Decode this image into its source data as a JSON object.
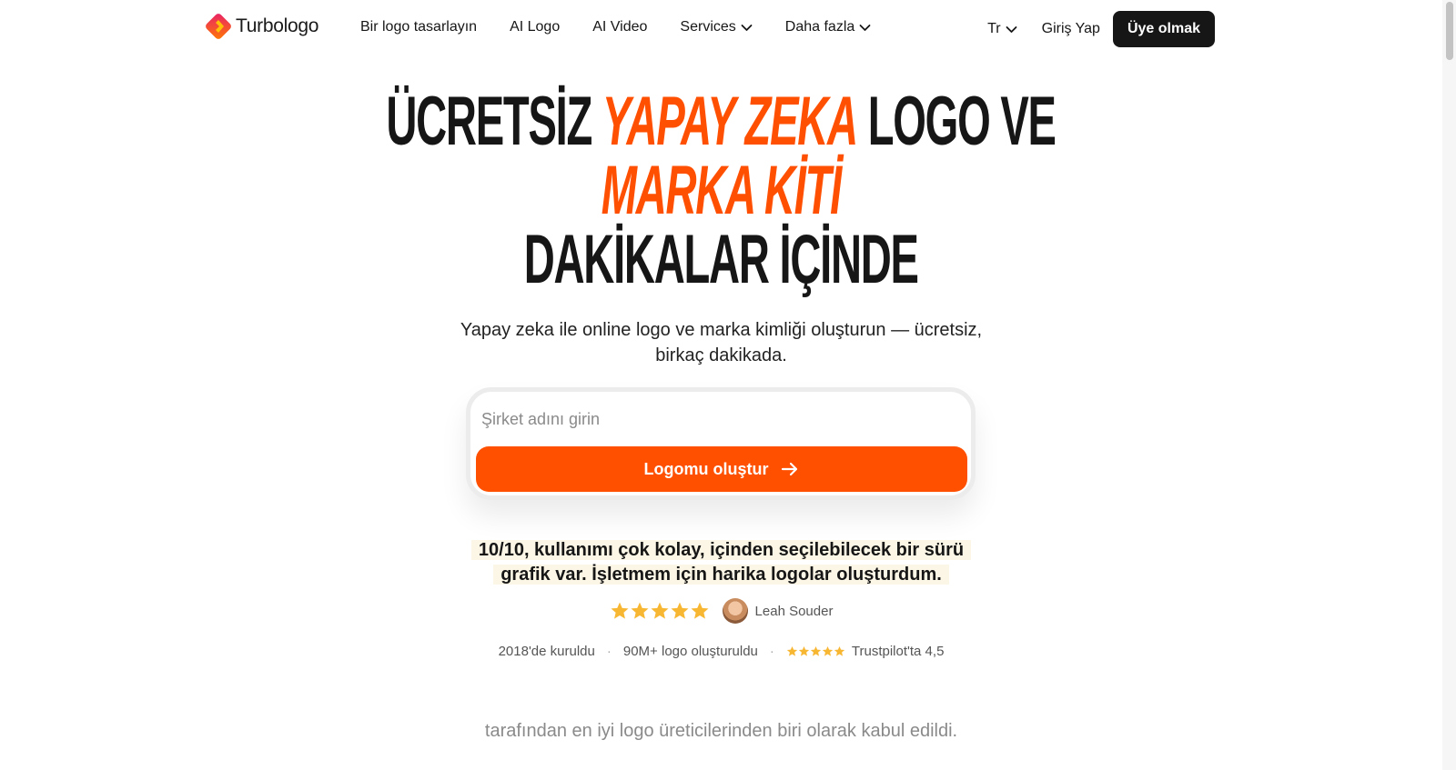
{
  "brand": {
    "name": "Turbologo",
    "accent": "#ff4f00",
    "dark": "#161616"
  },
  "nav": {
    "items": [
      {
        "label": "Bir logo tasarlayın"
      },
      {
        "label": "AI Logo"
      },
      {
        "label": "AI Video"
      },
      {
        "label": "Services",
        "icon": "chevron-down-icon"
      },
      {
        "label": "Daha fazla",
        "icon": "chevron-down-icon"
      }
    ],
    "language": "Tr",
    "login": "Giriş Yap",
    "signup": "Üye olmak"
  },
  "hero": {
    "line1_black": "ÜCRETSİZ",
    "line1_orange": "YAPAY ZEKA",
    "line1_black_end": "LOGO VE",
    "line2_orange": "MARKA KİTİ",
    "line3_black": "DAKİKALAR İÇİNDE",
    "subtitle_line1": "Yapay zeka ile online logo ve marka kimliği oluşturun — ücretsiz,",
    "subtitle_line2": "birkaç dakikada."
  },
  "form": {
    "placeholder": "Şirket adını girin",
    "value": "",
    "button_label": "Logomu oluştur",
    "button_icon": "arrow-right-icon"
  },
  "review": {
    "quote_line1": "10/10, kullanımı çok kolay, içinden seçilebilecek bir sürü",
    "quote_line2": "grafik var. İşletmem için harika logolar oluşturdum.",
    "rating": 5,
    "reviewer": "Leah Souder"
  },
  "stats": {
    "founded": "2018'de kuruldu",
    "logos": "90M+ logo oluşturuldu",
    "trustpilot": "Trustpilot'ta 4,5",
    "trustpilot_stars": 5
  },
  "recognition": "tarafından en iyi logo üreticilerinden biri olarak kabul edildi."
}
